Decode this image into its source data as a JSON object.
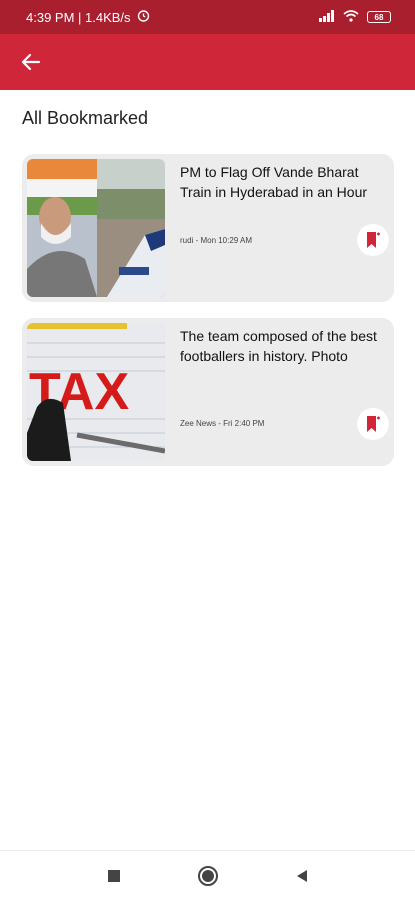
{
  "status_bar": {
    "time_speed": "4:39 PM | 1.4KB/s",
    "battery": "68"
  },
  "app_bar": {
    "back_icon": "arrow-left-icon"
  },
  "page": {
    "title": "All Bookmarked"
  },
  "articles": [
    {
      "headline": "PM to Flag Off Vande Bharat Train in Hyderabad in an Hour",
      "meta": "rudi - Mon 10:29 AM",
      "bookmark_icon": "bookmark-icon"
    },
    {
      "headline": "The team composed of the best footballers in history. Photo",
      "meta": "Zee News - Fri 2:40 PM",
      "thumb_text": "TAX",
      "bookmark_icon": "bookmark-icon"
    }
  ],
  "colors": {
    "status_bar": "#a91f2e",
    "app_bar": "#d0263a",
    "card_bg": "#ececec",
    "accent": "#d0263a"
  },
  "nav_bar": {
    "icons": [
      "square-recents-icon",
      "circle-home-icon",
      "triangle-back-icon"
    ]
  }
}
